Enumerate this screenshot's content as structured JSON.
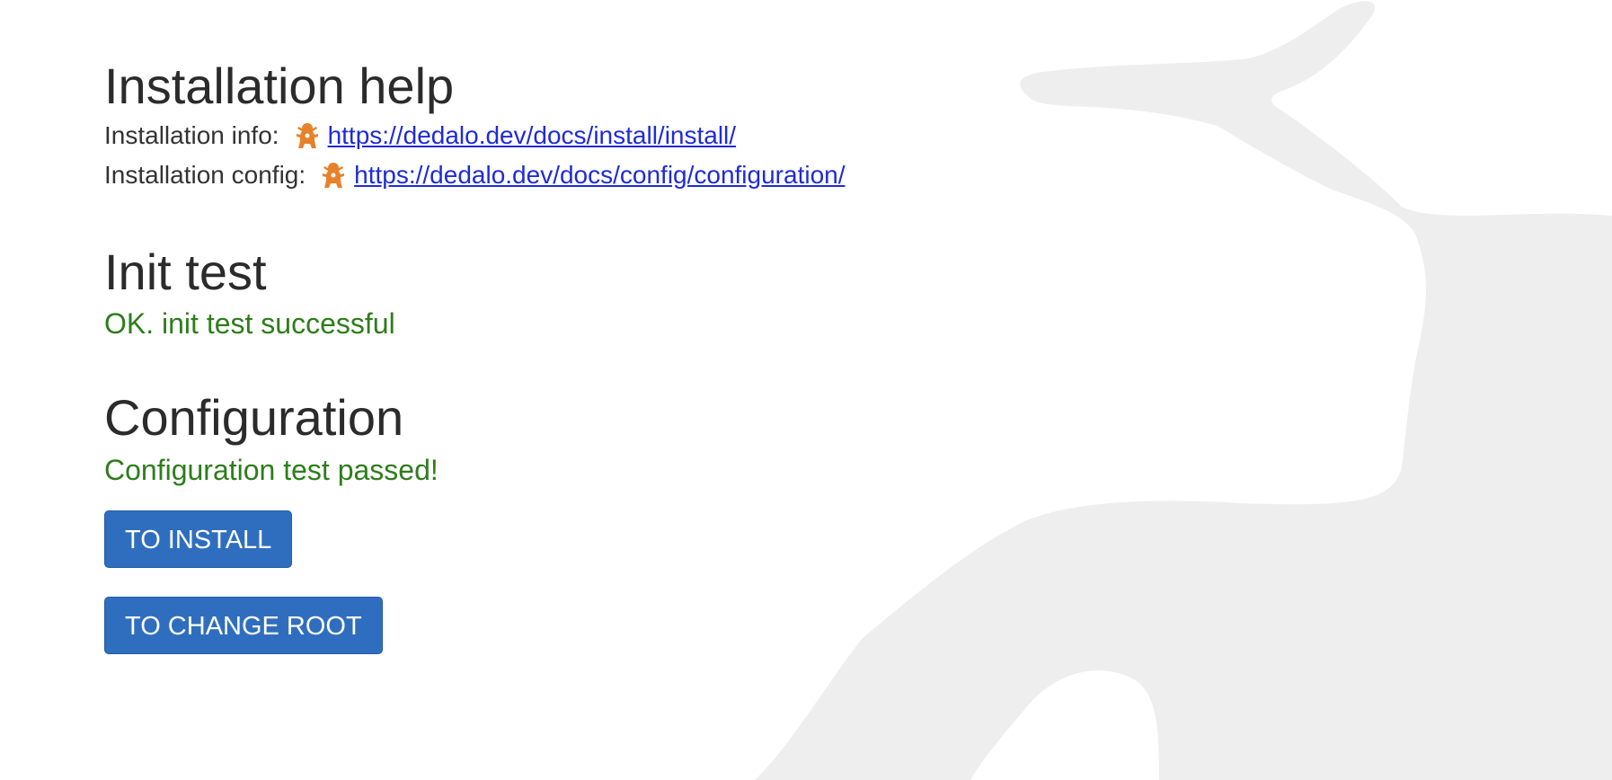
{
  "installation_help": {
    "title": "Installation help",
    "rows": [
      {
        "label": "Installation info:",
        "url": "https://dedalo.dev/docs/install/install/"
      },
      {
        "label": "Installation config:",
        "url": "https://dedalo.dev/docs/config/configuration/"
      }
    ]
  },
  "init_test": {
    "title": "Init test",
    "status": "OK. init test successful",
    "status_color": "#2e7d1b"
  },
  "configuration": {
    "title": "Configuration",
    "status": "Configuration test passed!",
    "status_color": "#2e7d1b"
  },
  "buttons": {
    "install_label": "TO INSTALL",
    "change_root_label": "TO CHANGE ROOT",
    "color": "#2f6ebf"
  },
  "icons": {
    "logo": "dedalo-logo-icon",
    "background": "dedalo-watermark-shape"
  }
}
